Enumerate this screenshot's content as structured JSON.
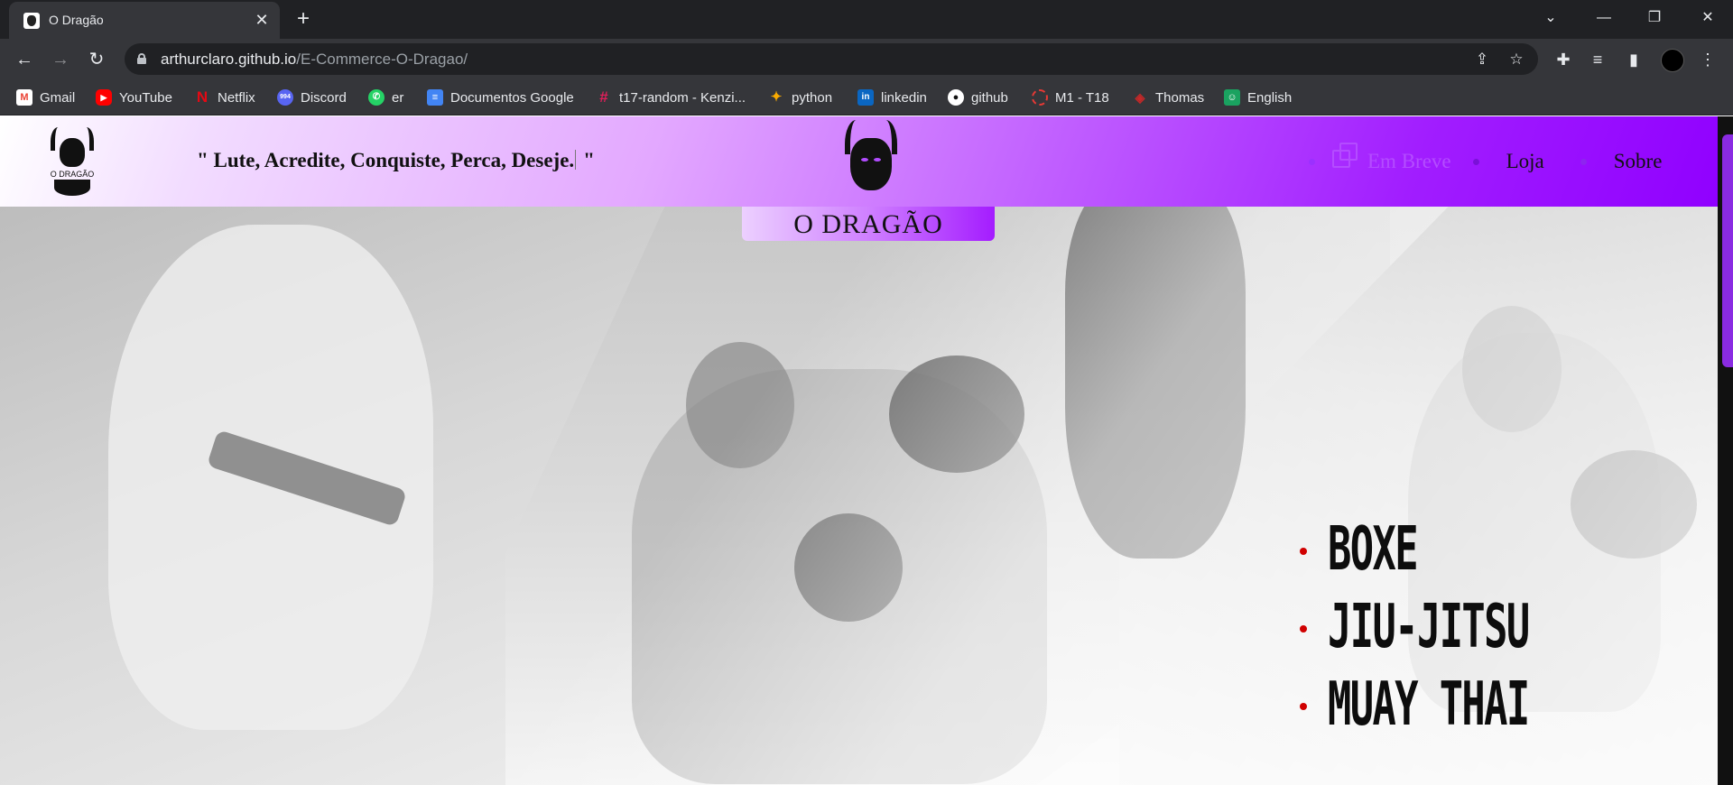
{
  "browser": {
    "tab_title": "O Dragão",
    "url_host": "arthurclaro.github.io",
    "url_path": "/E-Commerce-O-Dragao/",
    "bookmarks": [
      {
        "label": "Gmail",
        "icon": "gmail-icon",
        "color": "#ea4335"
      },
      {
        "label": "YouTube",
        "icon": "youtube-icon",
        "color": "#ff0000"
      },
      {
        "label": "Netflix",
        "icon": "netflix-icon",
        "color": "#e50914"
      },
      {
        "label": "Discord",
        "icon": "discord-icon",
        "color": "#5865f2",
        "badge": "994"
      },
      {
        "label": "er",
        "icon": "whatsapp-icon",
        "color": "#25d366"
      },
      {
        "label": "Documentos Google",
        "icon": "google-docs-icon",
        "color": "#4285f4"
      },
      {
        "label": "t17-random - Kenzi...",
        "icon": "slack-icon",
        "color": "#e01e5a"
      },
      {
        "label": "python",
        "icon": "colab-icon",
        "color": "#f9ab00"
      },
      {
        "label": "linkedin",
        "icon": "linkedin-icon",
        "color": "#0a66c2"
      },
      {
        "label": "github",
        "icon": "github-icon",
        "color": "#ffffff"
      },
      {
        "label": "M1 - T18",
        "icon": "kenzie-icon",
        "color": "#e53935"
      },
      {
        "label": "Thomas",
        "icon": "thomas-icon",
        "color": "#c62828"
      },
      {
        "label": "English",
        "icon": "classroom-icon",
        "color": "#1e88e5"
      }
    ]
  },
  "header": {
    "logo_small_name": "O DRAGÃO",
    "motto_open": "\" Lute, Acredite, Conquiste, Perca, Deseje.",
    "motto_close": "\"",
    "nav": {
      "soon_label": "Em Breve",
      "store_label": "Loja",
      "about_label": "Sobre"
    },
    "accent_color": "#9000ff"
  },
  "brand": {
    "name": "O DRAGÃO"
  },
  "disciplines": [
    "BOXE",
    "JIU-JITSU",
    "MUAY THAI"
  ]
}
